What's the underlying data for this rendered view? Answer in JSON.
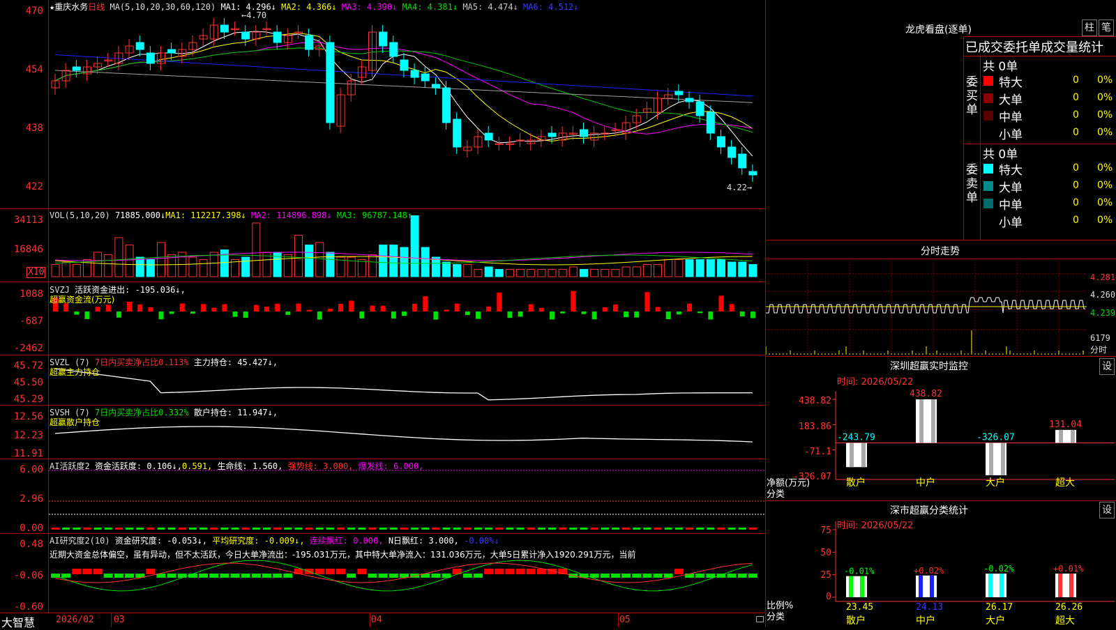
{
  "app": {
    "name": "大智慧"
  },
  "main_header": {
    "stock": "★重庆水务",
    "period": "日线",
    "ma_label": "MA(5,10,20,30,60,120)",
    "ma1": "MA1: 4.296↓",
    "ma2": "MA2: 4.366↓",
    "ma3": "MA3: 4.390↓",
    "ma4": "MA4: 4.381↓",
    "ma5": "MA5: 4.474↓",
    "ma6": "MA6: 4.512↓",
    "high_mark": "4.70",
    "low_mark": "4.22"
  },
  "price_axis": {
    "t1": "470",
    "t2": "454",
    "t3": "438",
    "t4": "422"
  },
  "vol_panel": {
    "label": "VOL(5,10,20)",
    "value": "71885.000↓",
    "ma1": "MA1: 112217.398↓",
    "ma2": "MA2: 114896.898↓",
    "ma3": "MA3: 96787.148↑",
    "axis_top": "34113",
    "axis_mid": "16846",
    "unit": "X10"
  },
  "svzj_panel": {
    "label": "SVZJ",
    "line1": "活跃资金进出: -195.036↓,",
    "line2": "超赢资金流(万元)",
    "axis1": "1088",
    "axis2": "-687",
    "axis3": "-2462"
  },
  "svzl_panel": {
    "label": "SVZL (7)",
    "stat": "7日内买卖净占比0.113%",
    "hold": "主力持仓: 45.427↓,",
    "line2": "超赢主力持仓",
    "axis1": "45.72",
    "axis2": "45.50",
    "axis3": "45.29"
  },
  "svsh_panel": {
    "label": "SVSH (7)",
    "stat": "7日内买卖净占比0.332%",
    "hold": "散户持仓: 11.947↓,",
    "line2": "超赢散户持仓",
    "axis1": "12.56",
    "axis2": "12.23",
    "axis3": "11.91"
  },
  "ai_active": {
    "label": "AI活跃度2",
    "deg": "资金活跃度: 0.106↓,",
    "deg2": "0.591,",
    "life": "生命线: 1.560,",
    "strong": "强势线: 3.000,",
    "burst": "爆发线: 6.000,",
    "axis1": "6.00",
    "axis2": "2.96",
    "axis3": "0.00"
  },
  "ai_research": {
    "label": "AI研究度2(10)",
    "deg": "资金研究度: -0.053↓,",
    "avg": "平均研究度: -0.009↓,",
    "red1": "连续飘红: 0.000,",
    "red2": "N日飘红: 3.000,",
    "last": "-0.00%↓",
    "comment": "近期大资金总体偏空，虽有异动，但不太活跃，今日大单净流出：-195.031万元，其中特大单净流入：131.036万元，大单5日累计净入1920.291万元，当前",
    "axis1": "0.48",
    "axis2": "-0.06",
    "axis3": "-0.60"
  },
  "date_axis": {
    "d1": "2026/02",
    "d2": "03",
    "d3": "04",
    "d4": "05"
  },
  "right_panel": {
    "title": "龙虎看盘(逐单)",
    "btn1": "柱",
    "btn2": "笔",
    "stat_title": "已成交委托单成交量统计",
    "buy_total": "共 0单",
    "buy_side_label": "委买单",
    "sell_total": "共 0单",
    "sell_side_label": "委卖单",
    "buy_rows": [
      {
        "label": "特大",
        "count": "0",
        "pct": "0%",
        "color": "#ff0000"
      },
      {
        "label": "大单",
        "count": "0",
        "pct": "0%",
        "color": "#8b0000"
      },
      {
        "label": "中单",
        "count": "0",
        "pct": "0%",
        "color": "#5a0000"
      },
      {
        "label": "小单",
        "count": "0",
        "pct": "0%",
        "color": "#000000"
      }
    ],
    "sell_rows": [
      {
        "label": "特大",
        "count": "0",
        "pct": "0%",
        "color": "#00ffff"
      },
      {
        "label": "大单",
        "count": "0",
        "pct": "0%",
        "color": "#008b8b"
      },
      {
        "label": "中单",
        "count": "0",
        "pct": "0%",
        "color": "#006a6a"
      },
      {
        "label": "小单",
        "count": "0",
        "pct": "0%",
        "color": "#000000"
      }
    ],
    "intraday_title": "分时走势",
    "intraday_p1": "4.281",
    "intraday_p2": "4.260",
    "intraday_p3": "4.239",
    "intraday_vol": "6179",
    "intraday_vol_unit": "分时"
  },
  "monitor_panel": {
    "title": "深圳超赢实时监控",
    "set": "设",
    "time": "时间: 2026/05/22",
    "axis1": "438.82",
    "axis2": "183.86",
    "axis3": "-71.1",
    "axis4": "-326.07",
    "ylabel1": "净额(万元)",
    "ylabel2": "分类",
    "cats": [
      "散户",
      "中户",
      "大户",
      "超大"
    ],
    "values": [
      -243.79,
      438.82,
      -326.07,
      131.04
    ],
    "labels": [
      "-243.79",
      "438.82",
      "-326.07",
      "131.04"
    ]
  },
  "stats_panel": {
    "title": "深市超赢分类统计",
    "set": "设",
    "time": "时间: 2026/05/22",
    "axis1": "75",
    "axis2": "50",
    "axis3": "25",
    "axis4": "0",
    "ylabel1": "比例%",
    "ylabel2": "分类",
    "cats": [
      "散户",
      "中户",
      "大户",
      "超大"
    ],
    "values": [
      23.45,
      24.13,
      26.17,
      26.26
    ],
    "labels": [
      "23.45",
      "24.13",
      "26.17",
      "26.26"
    ],
    "changes": [
      "-0.01%",
      "+0.02%",
      "-0.02%",
      "+0.01%"
    ]
  },
  "colors": {
    "up": "#ff3232",
    "down": "#00ffff",
    "ma1": "#ffffff",
    "ma2": "#ffff00",
    "ma3": "#ff00ff",
    "ma4": "#00c800",
    "ma5": "#a0a0a0",
    "ma6": "#2020ff",
    "grid": "#b00000"
  }
}
